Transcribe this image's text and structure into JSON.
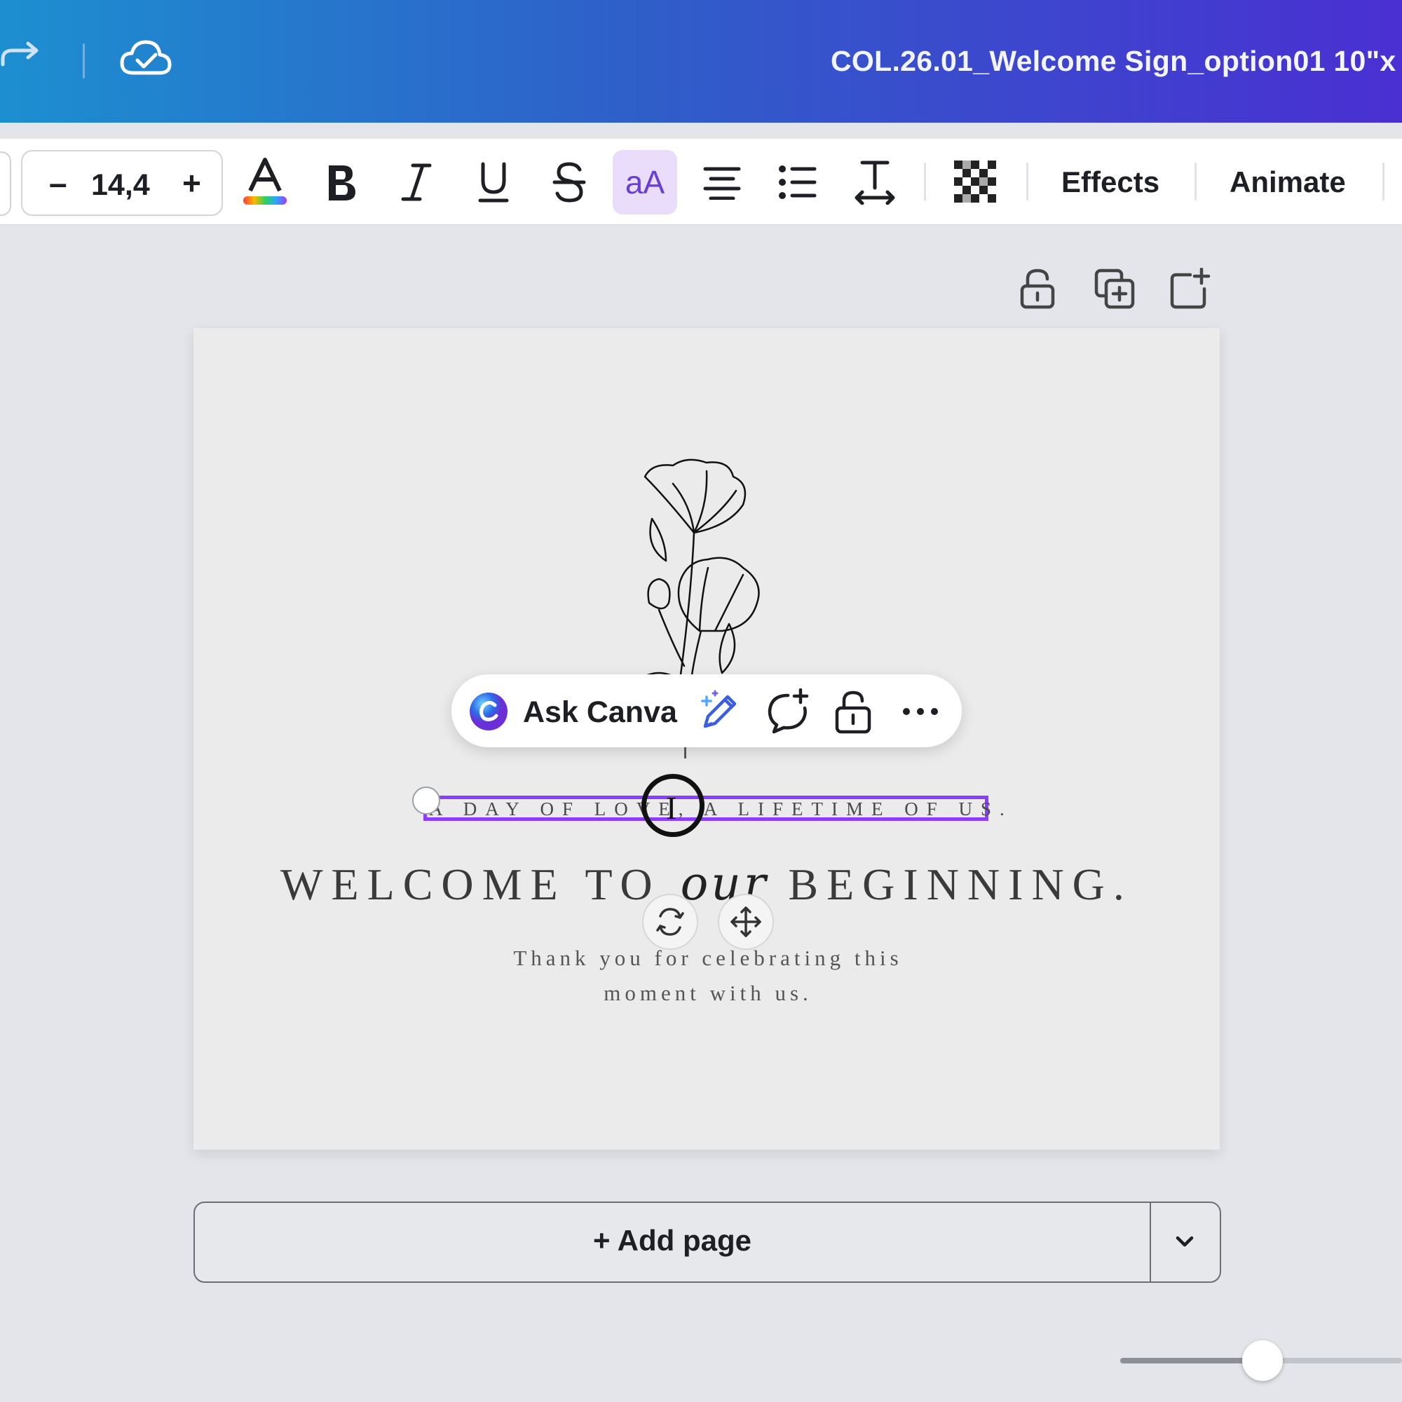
{
  "header": {
    "document_title": "COL.26.01_Welcome Sign_option01 10\"x"
  },
  "toolbar": {
    "font_size": "14,4",
    "minus_label": "–",
    "plus_label": "+",
    "effects_label": "Effects",
    "animate_label": "Animate",
    "icons": [
      "text-color-icon",
      "bold-icon",
      "italic-icon",
      "underline-icon",
      "strikethrough-icon",
      "letter-case-icon",
      "align-center-icon",
      "bullet-list-icon",
      "spacing-icon",
      "transparency-icon"
    ]
  },
  "context_menu": {
    "ask_label": "Ask Canva"
  },
  "design": {
    "tagline": "A DAY OF LOVE, A LIFETIME OF US.",
    "welcome_start": "WELCOME TO",
    "welcome_script": "our",
    "welcome_end": "BEGINNING.",
    "thanks_line1": "Thank you for celebrating this",
    "thanks_line2": "moment with us."
  },
  "footer": {
    "add_page_label": "+ Add page"
  },
  "colors": {
    "accent": "#8b3dff",
    "header_start": "#1d8fd0",
    "header_end": "#4a2fd2"
  }
}
